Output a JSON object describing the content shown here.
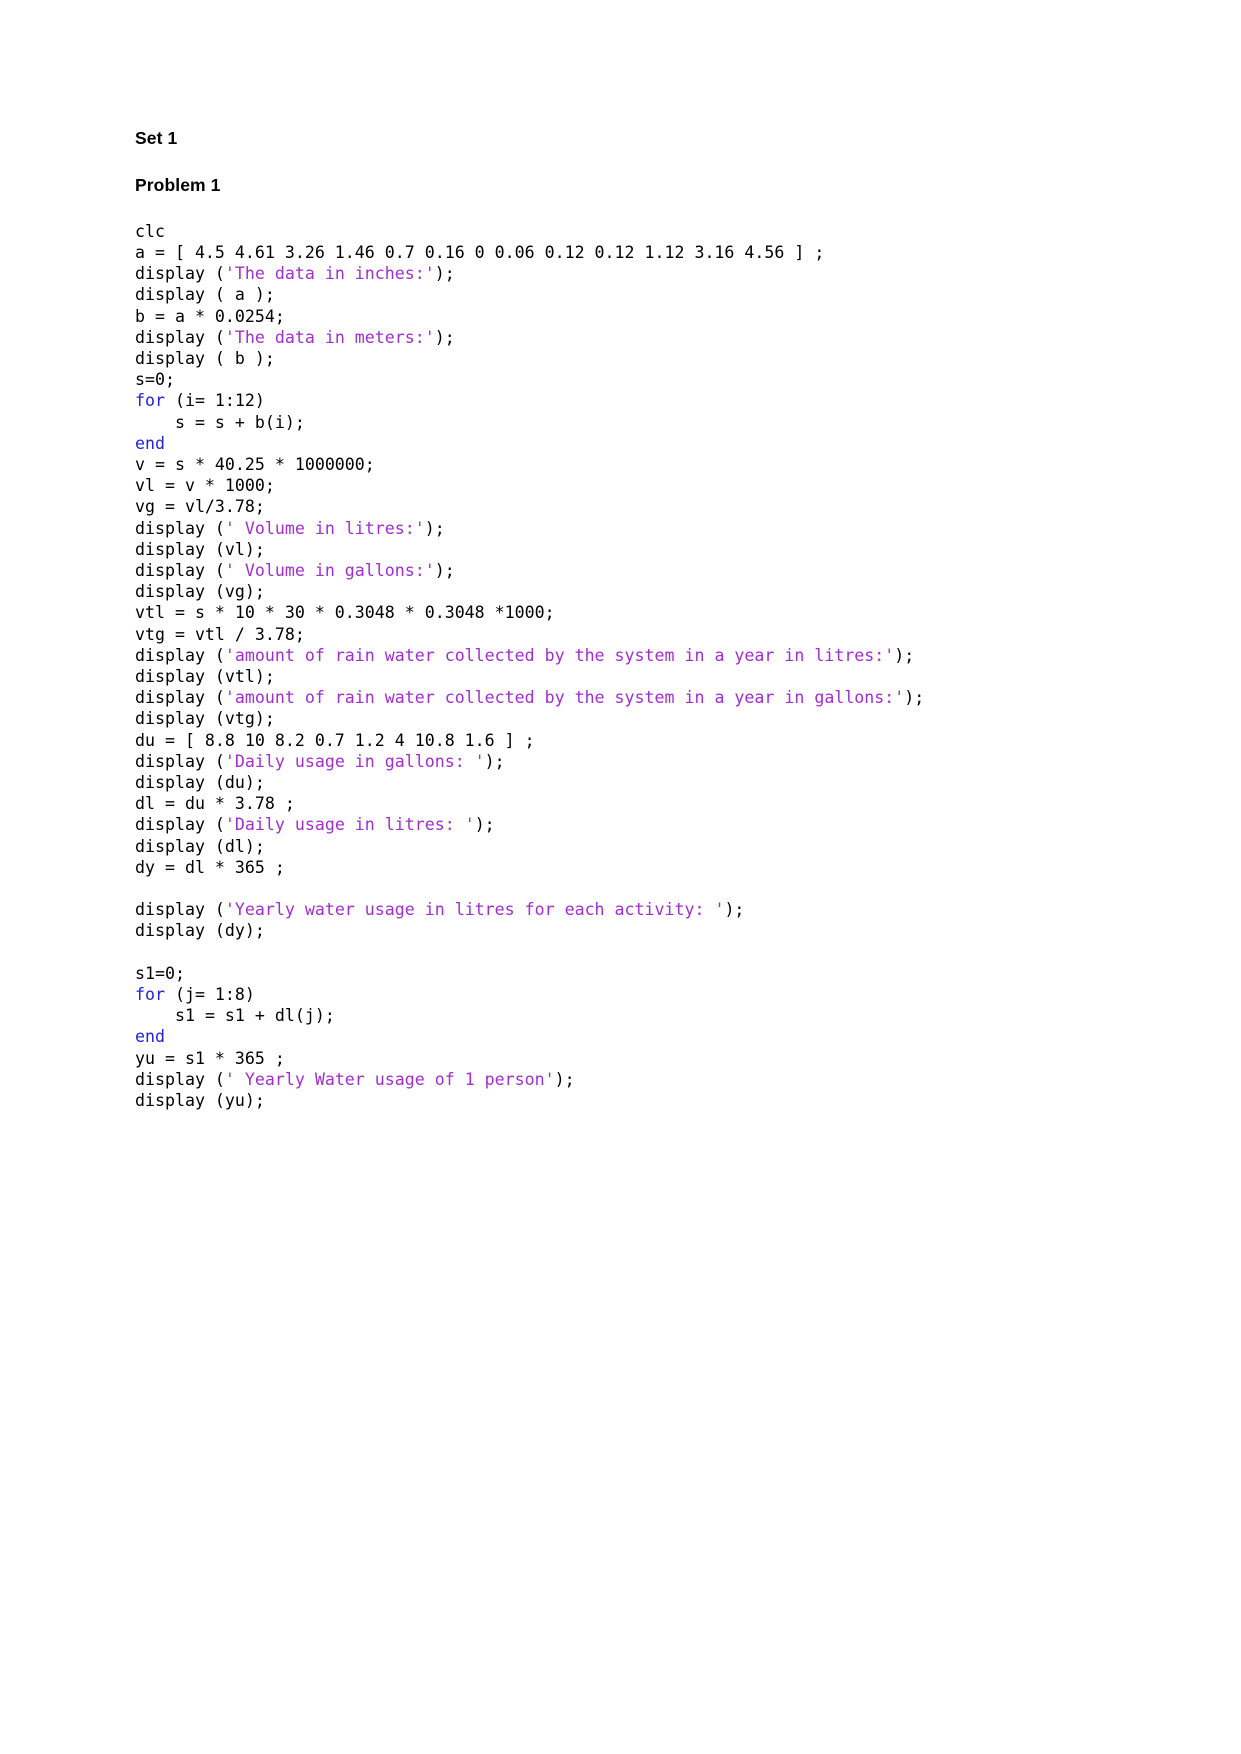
{
  "document": {
    "headings": {
      "set": "Set 1",
      "problem": "Problem 1"
    },
    "code_language": "matlab",
    "colors": {
      "text": "#000000",
      "string": "#a22ed2",
      "keyword": "#2222e0",
      "background": "#ffffff"
    },
    "code_lines": [
      {
        "id": "line-1",
        "tokens": [
          {
            "type": "plain",
            "text": "clc"
          }
        ]
      },
      {
        "id": "line-2",
        "tokens": [
          {
            "type": "plain",
            "text": "a = [ 4.5 4.61 3.26 1.46 0.7 0.16 0 0.06 0.12 0.12 1.12 3.16 4.56 ] ;"
          }
        ]
      },
      {
        "id": "line-3",
        "tokens": [
          {
            "type": "plain",
            "text": "display ("
          },
          {
            "type": "string",
            "text": "'The data in inches:'"
          },
          {
            "type": "plain",
            "text": ");"
          }
        ]
      },
      {
        "id": "line-4",
        "tokens": [
          {
            "type": "plain",
            "text": "display ( a );"
          }
        ]
      },
      {
        "id": "line-5",
        "tokens": [
          {
            "type": "plain",
            "text": "b = a * 0.0254;"
          }
        ]
      },
      {
        "id": "line-6",
        "tokens": [
          {
            "type": "plain",
            "text": "display ("
          },
          {
            "type": "string",
            "text": "'The data in meters:'"
          },
          {
            "type": "plain",
            "text": ");"
          }
        ]
      },
      {
        "id": "line-7",
        "tokens": [
          {
            "type": "plain",
            "text": "display ( b );"
          }
        ]
      },
      {
        "id": "line-8",
        "tokens": [
          {
            "type": "plain",
            "text": "s=0;"
          }
        ]
      },
      {
        "id": "line-9",
        "tokens": [
          {
            "type": "keyword",
            "text": "for"
          },
          {
            "type": "plain",
            "text": " (i= 1:12)"
          }
        ]
      },
      {
        "id": "line-10",
        "tokens": [
          {
            "type": "plain",
            "text": "    s = s + b(i);"
          }
        ]
      },
      {
        "id": "line-11",
        "tokens": [
          {
            "type": "keyword",
            "text": "end"
          }
        ]
      },
      {
        "id": "line-12",
        "tokens": [
          {
            "type": "plain",
            "text": "v = s * 40.25 * 1000000;"
          }
        ]
      },
      {
        "id": "line-13",
        "tokens": [
          {
            "type": "plain",
            "text": "vl = v * 1000;"
          }
        ]
      },
      {
        "id": "line-14",
        "tokens": [
          {
            "type": "plain",
            "text": "vg = vl/3.78;"
          }
        ]
      },
      {
        "id": "line-15",
        "tokens": [
          {
            "type": "plain",
            "text": "display ("
          },
          {
            "type": "string",
            "text": "' Volume in litres:'"
          },
          {
            "type": "plain",
            "text": ");"
          }
        ]
      },
      {
        "id": "line-16",
        "tokens": [
          {
            "type": "plain",
            "text": "display (vl);"
          }
        ]
      },
      {
        "id": "line-17",
        "tokens": [
          {
            "type": "plain",
            "text": "display ("
          },
          {
            "type": "string",
            "text": "' Volume in gallons:'"
          },
          {
            "type": "plain",
            "text": ");"
          }
        ]
      },
      {
        "id": "line-18",
        "tokens": [
          {
            "type": "plain",
            "text": "display (vg);"
          }
        ]
      },
      {
        "id": "line-19",
        "tokens": [
          {
            "type": "plain",
            "text": "vtl = s * 10 * 30 * 0.3048 * 0.3048 *1000;"
          }
        ]
      },
      {
        "id": "line-20",
        "tokens": [
          {
            "type": "plain",
            "text": "vtg = vtl / 3.78;"
          }
        ]
      },
      {
        "id": "line-21",
        "tokens": [
          {
            "type": "plain",
            "text": "display ("
          },
          {
            "type": "string",
            "text": "'amount of rain water collected by the system in a year in litres:'"
          },
          {
            "type": "plain",
            "text": ");"
          }
        ]
      },
      {
        "id": "line-22",
        "tokens": [
          {
            "type": "plain",
            "text": "display (vtl);"
          }
        ]
      },
      {
        "id": "line-23",
        "tokens": [
          {
            "type": "plain",
            "text": "display ("
          },
          {
            "type": "string",
            "text": "'amount of rain water collected by the system in a year in gallons:'"
          },
          {
            "type": "plain",
            "text": ");"
          }
        ]
      },
      {
        "id": "line-24",
        "tokens": [
          {
            "type": "plain",
            "text": "display (vtg);"
          }
        ]
      },
      {
        "id": "line-25",
        "tokens": [
          {
            "type": "plain",
            "text": "du = [ 8.8 10 8.2 0.7 1.2 4 10.8 1.6 ] ;"
          }
        ]
      },
      {
        "id": "line-26",
        "tokens": [
          {
            "type": "plain",
            "text": "display ("
          },
          {
            "type": "string",
            "text": "'Daily usage in gallons: '"
          },
          {
            "type": "plain",
            "text": ");"
          }
        ]
      },
      {
        "id": "line-27",
        "tokens": [
          {
            "type": "plain",
            "text": "display (du);"
          }
        ]
      },
      {
        "id": "line-28",
        "tokens": [
          {
            "type": "plain",
            "text": "dl = du * 3.78 ;"
          }
        ]
      },
      {
        "id": "line-29",
        "tokens": [
          {
            "type": "plain",
            "text": "display ("
          },
          {
            "type": "string",
            "text": "'Daily usage in litres: '"
          },
          {
            "type": "plain",
            "text": ");"
          }
        ]
      },
      {
        "id": "line-30",
        "tokens": [
          {
            "type": "plain",
            "text": "display (dl);"
          }
        ]
      },
      {
        "id": "line-31",
        "tokens": [
          {
            "type": "plain",
            "text": "dy = dl * 365 ;"
          }
        ]
      },
      {
        "id": "line-32",
        "tokens": []
      },
      {
        "id": "line-33",
        "tokens": [
          {
            "type": "plain",
            "text": "display ("
          },
          {
            "type": "string",
            "text": "'Yearly water usage in litres for each activity: '"
          },
          {
            "type": "plain",
            "text": ");"
          }
        ]
      },
      {
        "id": "line-34",
        "tokens": [
          {
            "type": "plain",
            "text": "display (dy);"
          }
        ]
      },
      {
        "id": "line-35",
        "tokens": []
      },
      {
        "id": "line-36",
        "tokens": [
          {
            "type": "plain",
            "text": "s1=0;"
          }
        ]
      },
      {
        "id": "line-37",
        "tokens": [
          {
            "type": "keyword",
            "text": "for"
          },
          {
            "type": "plain",
            "text": " (j= 1:8)"
          }
        ]
      },
      {
        "id": "line-38",
        "tokens": [
          {
            "type": "plain",
            "text": "    s1 = s1 + dl(j);"
          }
        ]
      },
      {
        "id": "line-39",
        "tokens": [
          {
            "type": "keyword",
            "text": "end"
          }
        ]
      },
      {
        "id": "line-40",
        "tokens": [
          {
            "type": "plain",
            "text": "yu = s1 * 365 ;"
          }
        ]
      },
      {
        "id": "line-41",
        "tokens": [
          {
            "type": "plain",
            "text": "display ("
          },
          {
            "type": "string",
            "text": "' Yearly Water usage of 1 person'"
          },
          {
            "type": "plain",
            "text": ");"
          }
        ]
      },
      {
        "id": "line-42",
        "tokens": [
          {
            "type": "plain",
            "text": "display (yu);"
          }
        ]
      }
    ]
  }
}
